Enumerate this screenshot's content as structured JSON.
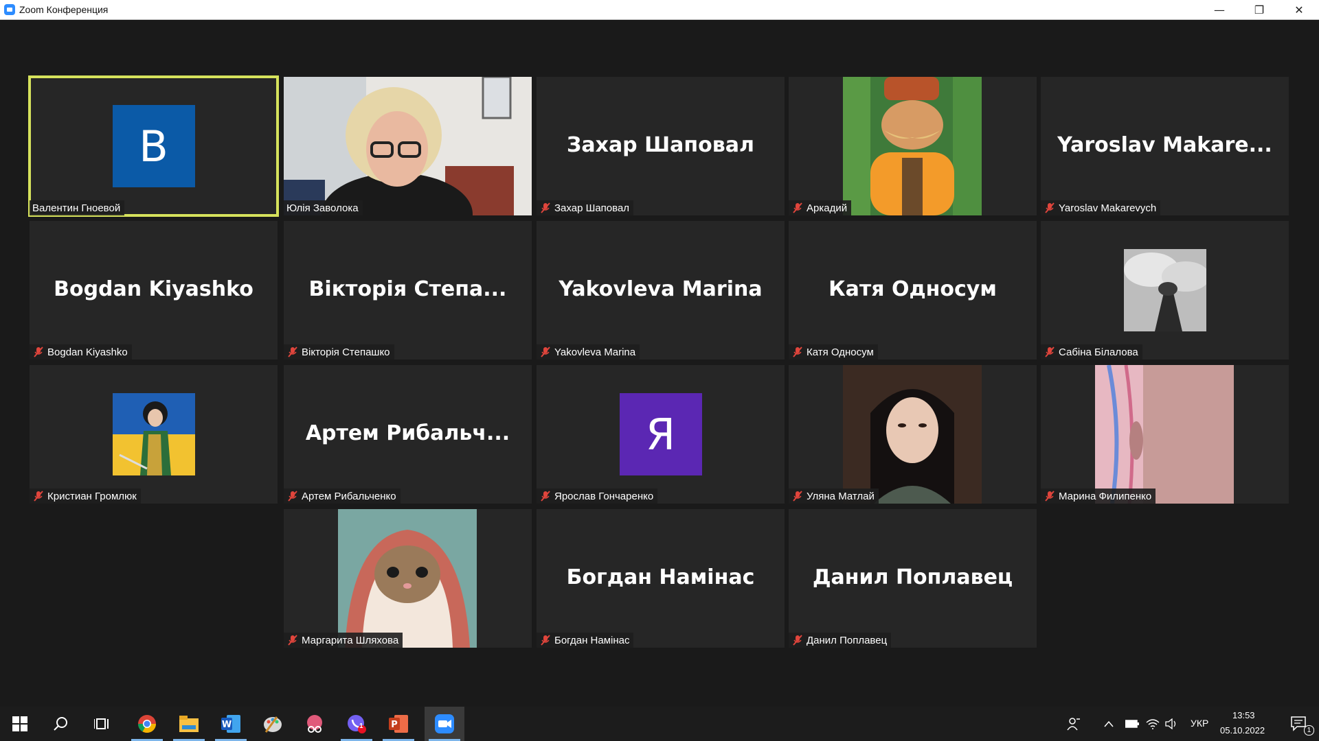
{
  "window": {
    "title": "Zoom Конференция",
    "controls": {
      "minimize": "—",
      "restore": "❐",
      "close": "✕"
    }
  },
  "accent_colors": {
    "active_speaker_border": "#d6e25c",
    "mute_icon": "#e0453c",
    "avatar_blue": "#0b5aa7",
    "avatar_purple": "#5b27b3"
  },
  "participants": [
    {
      "name": "Валентин Гноевой",
      "display": "avatar-letter",
      "letter": "В",
      "avatar_color": "#0b5aa7",
      "muted": false,
      "active_speaker": true
    },
    {
      "name": "Юлія Заволока",
      "display": "video",
      "muted": false
    },
    {
      "name": "Захар Шаповал",
      "display": "name-text",
      "center_text": "Захар Шаповал",
      "muted": true
    },
    {
      "name": "Аркадий",
      "display": "photo",
      "muted": true
    },
    {
      "name": "Yaroslav Makarevych",
      "display": "name-text",
      "center_text": "Yaroslav  Makare...",
      "muted": true
    },
    {
      "name": "Bogdan Kiyashko",
      "display": "name-text",
      "center_text": "Bogdan Kiyashko",
      "muted": true
    },
    {
      "name": "Вікторія Степашко",
      "display": "name-text",
      "center_text": "Вікторія Степа...",
      "muted": true
    },
    {
      "name": "Yakovleva Marina",
      "display": "name-text",
      "center_text": "Yakovleva Marina",
      "muted": true
    },
    {
      "name": "Катя Односум",
      "display": "name-text",
      "center_text": "Катя Односум",
      "muted": true
    },
    {
      "name": "Сабіна Білалова",
      "display": "small-picture",
      "muted": true
    },
    {
      "name": "Кристиан Громлюк",
      "display": "small-picture",
      "muted": true
    },
    {
      "name": "Артем Рибальченко",
      "display": "name-text",
      "center_text": "Артем  Рибальч...",
      "muted": true
    },
    {
      "name": "Ярослав Гончаренко",
      "display": "avatar-letter",
      "letter": "Я",
      "avatar_color": "#5b27b3",
      "muted": true
    },
    {
      "name": "Уляна Матлай",
      "display": "photo",
      "muted": true
    },
    {
      "name": "Марина Филипенко",
      "display": "photo",
      "muted": true
    },
    {
      "name": "Маргарита Шляхова",
      "display": "photo",
      "muted": true
    },
    {
      "name": "Богдан Намінас",
      "display": "name-text",
      "center_text": "Богдан Намінас",
      "muted": true
    },
    {
      "name": "Данил Поплавец",
      "display": "name-text",
      "center_text": "Данил Поплавец",
      "muted": true
    }
  ],
  "taskbar": {
    "apps": [
      "start-icon",
      "search-icon",
      "task-view-icon",
      "chrome-icon",
      "file-explorer-icon",
      "word-icon",
      "paint-icon",
      "snip-icon",
      "viber-icon",
      "powerpoint-icon",
      "zoom-icon"
    ],
    "viber_badge": "1",
    "language": "УКР",
    "time": "13:53",
    "date": "05.10.2022",
    "notification_count": "1"
  }
}
